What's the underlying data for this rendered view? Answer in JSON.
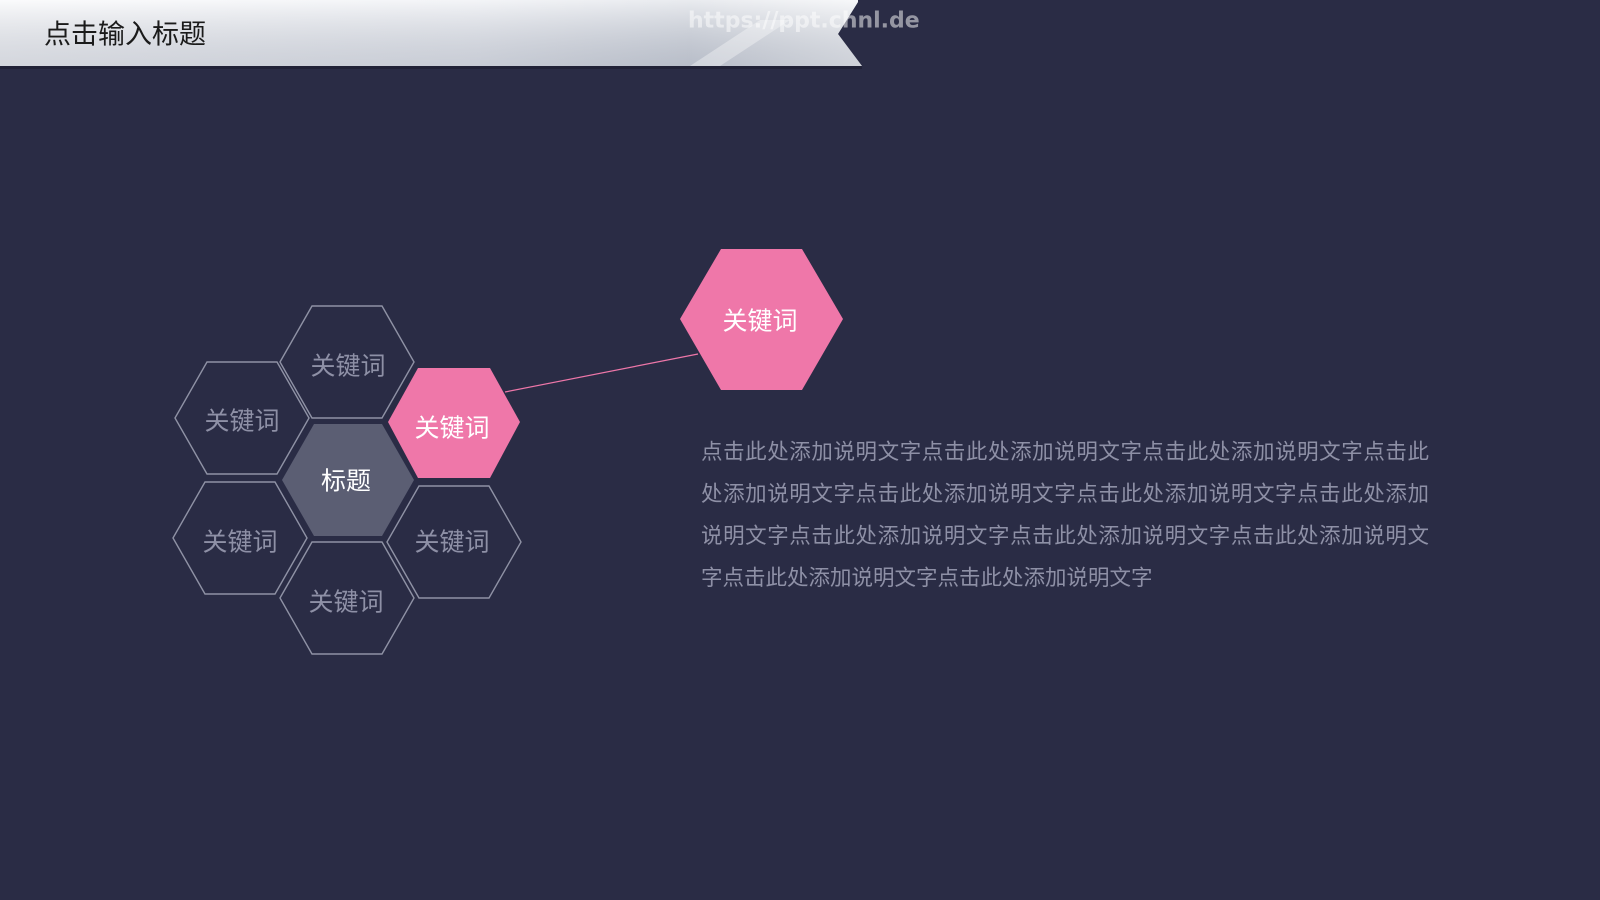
{
  "slide": {
    "title": "点击输入标题",
    "watermark": "https://ppt.chnl.de",
    "hexagons": {
      "top": "关键词",
      "upper_left": "关键词",
      "highlight": "关键词",
      "center": "标题",
      "lower_left": "关键词",
      "lower_right": "关键词",
      "bottom": "关键词",
      "callout": "关键词"
    },
    "description": "点击此处添加说明文字点击此处添加说明文字点击此处添加说明文字点击此处添加说明文字点击此处添加说明文字点击此处添加说明文字点击此处添加说明文字点击此处添加说明文字点击此处添加说明文字点击此处添加说明文字点击此处添加说明文字点击此处添加说明文字",
    "colors": {
      "background": "#2a2c45",
      "accent": "#ef77a9",
      "center_fill": "#5b5e73",
      "outline": "#8f92a5",
      "muted_text": "#8e90a6"
    }
  }
}
